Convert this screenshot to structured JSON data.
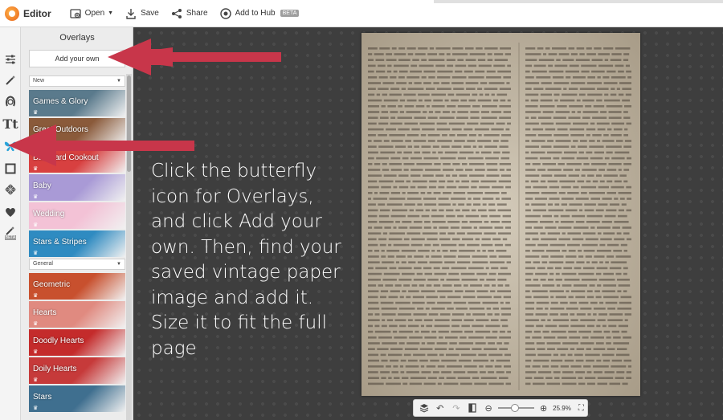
{
  "topbar": {
    "app_title": "Editor",
    "open_label": "Open",
    "save_label": "Save",
    "share_label": "Share",
    "hub_label": "Add to Hub",
    "beta_label": "BETA"
  },
  "iconbar": {
    "icons": [
      "sliders-icon",
      "magic-wand-icon",
      "face-icon",
      "text-icon",
      "butterfly-icon",
      "frame-icon",
      "texture-icon",
      "heart-brush-icon",
      "beta-tools-icon"
    ],
    "beta_label": "BETA"
  },
  "panel": {
    "title": "Overlays",
    "add_button": "Add your own",
    "filter_top": "New",
    "filter_bottom": "General",
    "tiles_top": [
      {
        "label": "Games & Glory",
        "color": "#5a7a8c"
      },
      {
        "label": "Great Outdoors",
        "color": "#8a5a3a"
      },
      {
        "label": "Backyard Cookout",
        "color": "#d84040"
      },
      {
        "label": "Baby",
        "color": "#a99ad6"
      },
      {
        "label": "Wedding",
        "color": "#f3c2d6"
      },
      {
        "label": "Stars & Stripes",
        "color": "#2f8bc1"
      }
    ],
    "tiles_bottom": [
      {
        "label": "Geometric",
        "color": "#c8502e"
      },
      {
        "label": "Hearts",
        "color": "#e08a80"
      },
      {
        "label": "Doodly Hearts",
        "color": "#c42b2b"
      },
      {
        "label": "Doily Hearts",
        "color": "#c63a3a"
      },
      {
        "label": "Stars",
        "color": "#3f6f8f"
      }
    ]
  },
  "instructions": "Click the butterfly icon for Overlays, and click Add your own. Then, find your saved vintage paper image and add it. Size it to fit the full page",
  "zoom": {
    "level": "25.9%",
    "fraction": 0.45
  },
  "colors": {
    "arrow": "#c8364a",
    "accent": "#29a3d9"
  }
}
